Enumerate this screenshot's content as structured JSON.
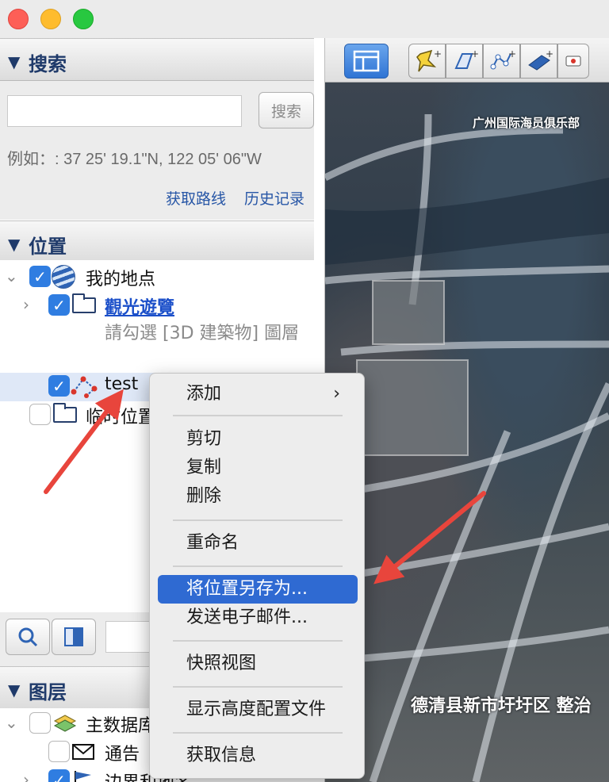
{
  "window": {
    "traffic_lights": [
      "close",
      "minimize",
      "zoom"
    ]
  },
  "search_panel": {
    "title": "搜索",
    "input_value": "",
    "search_button": "搜索",
    "example_text": "例如：: 37 25' 19.1\"N, 122 05' 06\"W",
    "links": [
      "获取路线",
      "历史记录"
    ]
  },
  "places_panel": {
    "title": "位置",
    "items": [
      {
        "label": "我的地点",
        "checked": true,
        "icon": "globe-icon",
        "expanded": true
      },
      {
        "label": "觀光遊覽",
        "checked": true,
        "icon": "folder-icon",
        "expanded": false,
        "linked": true
      },
      {
        "label": "請勾選 [3D 建築物] 圖層",
        "checked": null,
        "icon": "",
        "note": true
      },
      {
        "label": "test",
        "checked": true,
        "icon": "path-icon",
        "selected": true
      },
      {
        "label": "临时位置",
        "checked": false,
        "icon": "folder-icon"
      }
    ]
  },
  "layers_panel": {
    "title": "图层",
    "items": [
      {
        "label": "主数据库",
        "icon": "layers-icon"
      },
      {
        "label": "通告",
        "icon": "mail-icon"
      },
      {
        "label": "边界和地名",
        "icon": "flag-icon"
      }
    ]
  },
  "map": {
    "label_top": "广州国际海员俱乐部",
    "label_bottom": "德清县新市圩圩区 整治"
  },
  "context_menu": {
    "items": [
      {
        "label": "添加",
        "submenu": true
      },
      {
        "label": "剪切"
      },
      {
        "label": "复制"
      },
      {
        "label": "删除"
      },
      {
        "label": "重命名"
      },
      {
        "label": "将位置另存为...",
        "highlighted": true
      },
      {
        "label": "发送电子邮件..."
      },
      {
        "label": "快照视图"
      },
      {
        "label": "显示高度配置文件"
      },
      {
        "label": "获取信息"
      }
    ],
    "submenu_indicator": "›"
  },
  "colors": {
    "accent": "#2f6ad2",
    "header_text": "#1f3a6a",
    "link": "#2756a6",
    "annotation_arrow": "#e8453c"
  }
}
